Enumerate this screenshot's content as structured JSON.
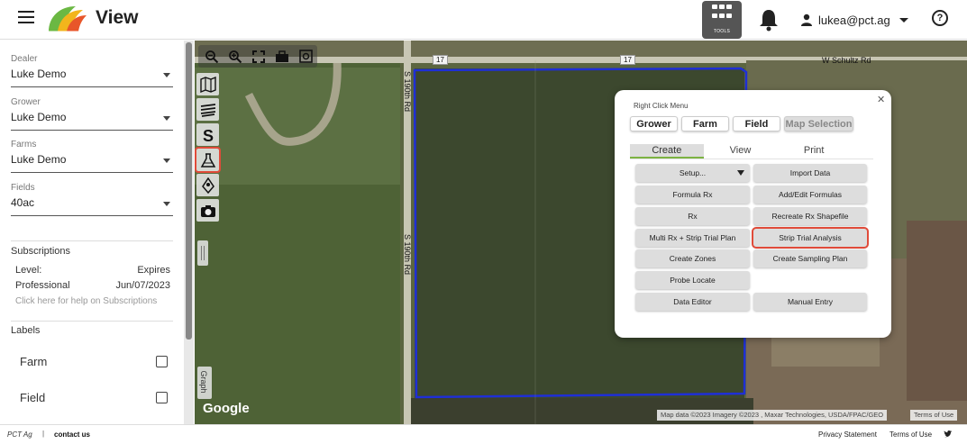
{
  "header": {
    "title": "View",
    "tools_label": "TOOLS",
    "user_email": "lukea@pct.ag",
    "help_symbol": "?",
    "icons": [
      "menu-icon",
      "app-logo",
      "tools-grid-icon",
      "bell-icon",
      "person-icon",
      "help-icon"
    ]
  },
  "sidebar": {
    "dealer": {
      "label": "Dealer",
      "value": "Luke Demo"
    },
    "grower": {
      "label": "Grower",
      "value": "Luke Demo"
    },
    "farms": {
      "label": "Farms",
      "value": "Luke Demo"
    },
    "fields": {
      "label": "Fields",
      "value": "40ac"
    },
    "subscriptions": {
      "heading": "Subscriptions",
      "level_label": "Level:",
      "expires_label": "Expires",
      "level": "Professional",
      "expires": "Jun/07/2023",
      "help_text": "Click here for help on Subscriptions"
    },
    "labels": {
      "heading": "Labels",
      "items": [
        {
          "label": "Farm",
          "checked": false
        },
        {
          "label": "Field",
          "checked": false
        }
      ]
    }
  },
  "map": {
    "road_labels": [
      "17",
      "17"
    ],
    "street_top": "W Schultz Rd",
    "street_left_1": "S 190th Rd",
    "street_left_2": "S 190th Rd",
    "google": "Google",
    "attribution": "Map data ©2023 Imagery ©2023 , Maxar Technologies, USDA/FPAC/GEO",
    "terms": "Terms of Use",
    "graph_tab": "Graph",
    "field_boundary_color": "#1f2fd6",
    "toolbar_icons": [
      "zoom-out-icon",
      "zoom-in-icon",
      "fit-extent-icon",
      "briefcase-icon",
      "screenshot-icon"
    ],
    "side_tool_icons": [
      "map-layers-icon",
      "imagery-layers-icon",
      "sampling-icon",
      "trial-flask-icon",
      "probe-icon",
      "camera-icon"
    ]
  },
  "right_click_menu": {
    "title": "Right Click Menu",
    "scope_buttons": [
      "Grower",
      "Farm",
      "Field",
      "Map Selection"
    ],
    "tabs": [
      "Create",
      "View",
      "Print"
    ],
    "active_tab": "Create",
    "buttons": {
      "setup": "Setup...",
      "import_data": "Import Data",
      "formula_rx": "Formula Rx",
      "add_edit_formulas": "Add/Edit Formulas",
      "rx": "Rx",
      "recreate_rx_shapefile": "Recreate Rx Shapefile",
      "multi_rx_strip": "Multi Rx + Strip Trial Plan",
      "strip_trial_analysis": "Strip Trial Analysis",
      "create_zones": "Create Zones",
      "create_sampling_plan": "Create Sampling Plan",
      "probe_locate": "Probe Locate",
      "data_editor": "Data Editor",
      "manual_entry": "Manual Entry"
    },
    "highlight_color": "#e04b3a"
  },
  "footer": {
    "brand": "PCT Ag",
    "separator": "|",
    "contact": "contact us",
    "privacy": "Privacy Statement",
    "terms": "Terms of Use"
  }
}
